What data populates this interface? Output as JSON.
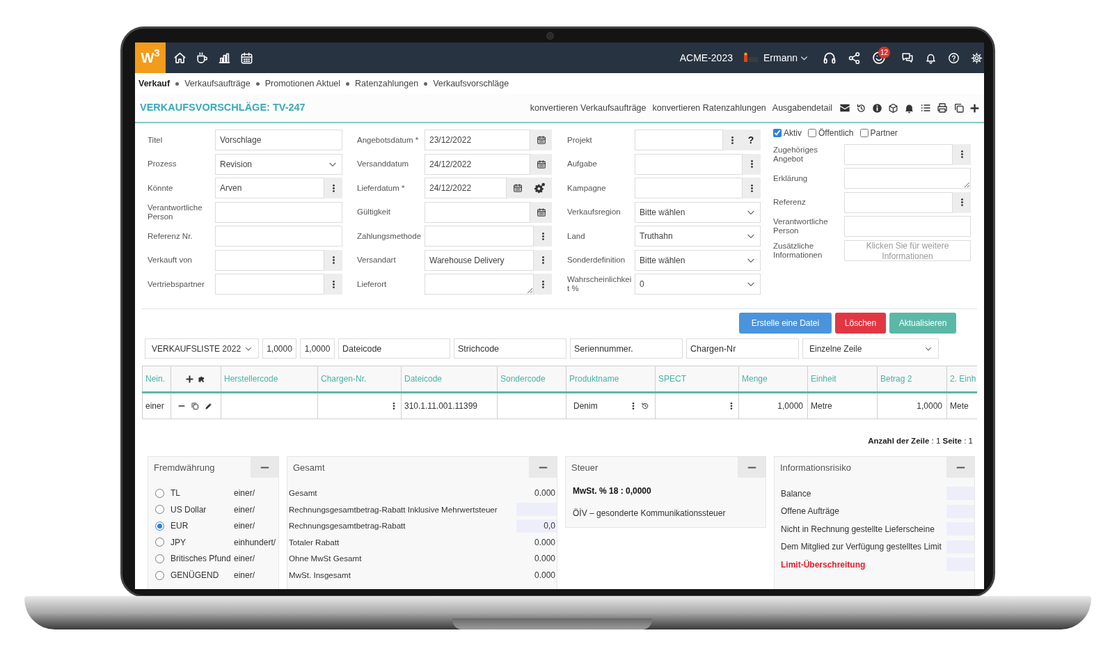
{
  "top_bar": {
    "logo": "W$^{3}$",
    "company": "ACME-2023",
    "user": "Ermann",
    "badge": "12"
  },
  "breadcrumb": [
    {
      "label": "Verkauf",
      "current": true
    },
    {
      "label": "Verkaufsaufträge",
      "current": false
    },
    {
      "label": "Promotionen Aktuel",
      "current": false
    },
    {
      "label": "Ratenzahlungen",
      "current": false
    },
    {
      "label": "Verkaufsvorschläge",
      "current": false
    }
  ],
  "page": {
    "title": "VERKAUFSVORSCHLÄGE: TV-247",
    "actions": [
      "konvertieren Verkaufsaufträge",
      "konvertieren Ratenzahlungen",
      "Ausgabendetail"
    ]
  },
  "form": {
    "columns": [
      {
        "fields": [
          {
            "label": "Titel",
            "kind": "text",
            "value": "Vorschlage"
          },
          {
            "label": "Prozess",
            "kind": "select",
            "value": "Revision"
          },
          {
            "label": "Könnte",
            "kind": "lookup",
            "value": "Arven"
          },
          {
            "label": "Verantwortliche Person",
            "kind": "text"
          },
          {
            "label": "Referenz Nr.",
            "kind": "text"
          },
          {
            "label": "Verkauft von",
            "kind": "lookup"
          },
          {
            "label": "Vertriebspartner",
            "kind": "lookup"
          }
        ]
      },
      {
        "fields": [
          {
            "label": "Angebotsdatum *",
            "kind": "date",
            "value": "23/12/2022"
          },
          {
            "label": "Versanddatum",
            "kind": "date",
            "value": "24/12/2022"
          },
          {
            "label": "Lieferdatum *",
            "kind": "date_config",
            "value": "24/12/2022"
          },
          {
            "label": "Gültigkeit",
            "kind": "date"
          },
          {
            "label": "Zahlungsmethode",
            "kind": "lookup"
          },
          {
            "label": "Versandart",
            "kind": "lookup",
            "value": "Warehouse Delivery"
          },
          {
            "label": "Lieferort",
            "kind": "textarea_lookup"
          }
        ]
      },
      {
        "fields": [
          {
            "label": "Projekt",
            "kind": "lookup_help",
            "help": "?"
          },
          {
            "label": "Aufgabe",
            "kind": "lookup"
          },
          {
            "label": "Kampagne",
            "kind": "lookup"
          },
          {
            "label": "Verkaufsregion",
            "kind": "select",
            "value": "Bitte wählen"
          },
          {
            "label": "Land",
            "kind": "select",
            "value": "Truthahn"
          },
          {
            "label": "Sonderdefinition",
            "kind": "select",
            "value": "Bitte wählen"
          },
          {
            "label": "Wahrscheinlichkeit %",
            "kind": "select",
            "value": "0"
          }
        ]
      },
      {
        "flags": [
          {
            "label": "Aktiv",
            "checked": true
          },
          {
            "label": "Öffentlich",
            "checked": false
          },
          {
            "label": "Partner",
            "checked": false
          }
        ],
        "fields": [
          {
            "label": "Zugehöriges Angebot",
            "kind": "lookup"
          },
          {
            "label": "Erklärung",
            "kind": "textarea"
          },
          {
            "label": "Referenz",
            "kind": "lookup"
          },
          {
            "label": "Verantwortliche Person",
            "kind": "text"
          },
          {
            "label": "Zusätzliche Informationen",
            "kind": "link_box",
            "placeholder": "Klicken Sie für weitere Informationen"
          }
        ]
      }
    ]
  },
  "buttons": [
    {
      "label": "Erstelle eine Datei",
      "kind": "primary"
    },
    {
      "label": "Löschen",
      "kind": "danger"
    },
    {
      "label": "Aktualisieren",
      "kind": "success"
    }
  ],
  "filters": [
    {
      "kind": "select",
      "value": "VERKAUFSLISTE 2022"
    },
    {
      "kind": "number",
      "value": "1,0000"
    },
    {
      "kind": "number",
      "value": "1,0000"
    },
    {
      "kind": "text",
      "placeholder": "Dateicode"
    },
    {
      "kind": "text",
      "placeholder": "Strichcode"
    },
    {
      "kind": "text",
      "placeholder": "Seriennummer."
    },
    {
      "kind": "text",
      "placeholder": "Chargen-Nr"
    },
    {
      "kind": "select",
      "value": "Einzelne Zeile"
    }
  ],
  "table": {
    "columns": [
      {
        "kind": "text",
        "label": "Nein."
      },
      {
        "kind": "actions"
      },
      {
        "kind": "text",
        "label": "Herstellercode"
      },
      {
        "kind": "text",
        "label": "Chargen-Nr."
      },
      {
        "kind": "text",
        "label": "Dateicode"
      },
      {
        "kind": "text",
        "label": "Sondercode"
      },
      {
        "kind": "text",
        "label": "Produktname"
      },
      {
        "kind": "text",
        "label": "SPECT"
      },
      {
        "kind": "text",
        "label": "Menge"
      },
      {
        "kind": "text",
        "label": "Einheit"
      },
      {
        "kind": "text",
        "label": "Betrag 2"
      },
      {
        "kind": "text",
        "label": "2. Einh"
      }
    ],
    "rows": [
      {
        "cells": [
          {
            "kind": "text",
            "text": "einer"
          },
          {
            "kind": "actions"
          },
          {
            "kind": "empty"
          },
          {
            "kind": "lookup"
          },
          {
            "kind": "text",
            "text": "310.1.11.001.11399"
          },
          {
            "kind": "empty"
          },
          {
            "kind": "product",
            "text": "Denim"
          },
          {
            "kind": "lookup"
          },
          {
            "kind": "number",
            "text": "1,0000"
          },
          {
            "kind": "text",
            "text": "Metre"
          },
          {
            "kind": "number",
            "text": "1,0000"
          },
          {
            "kind": "text",
            "text": "Mete"
          }
        ]
      }
    ]
  },
  "pager": "**Anzahl der Zeile** : 1 **Seite** : 1",
  "panels": {
    "currency": {
      "title": "Fremdwährung",
      "options": [
        {
          "label": "TL",
          "rate": "einer/",
          "selected": false
        },
        {
          "label": "US Dollar",
          "rate": "einer/",
          "selected": false
        },
        {
          "label": "EUR",
          "rate": "einer/",
          "selected": true
        },
        {
          "label": "JPY",
          "rate": "einhundert/",
          "selected": false
        },
        {
          "label": "Britisches Pfund",
          "rate": "einer/",
          "selected": false
        },
        {
          "label": "GENÜGEND",
          "rate": "einer/",
          "selected": false
        }
      ]
    },
    "totals": {
      "title": "Gesamt",
      "rows": [
        {
          "label": "Gesamt",
          "kind": "plain",
          "value": "0.000"
        },
        {
          "label": "Rechnungsgesamtbetrag-Rabatt Inklusive Mehrwertsteuer",
          "kind": "field"
        },
        {
          "label": "Rechnungsgesamtbetrag-Rabatt",
          "kind": "field",
          "value": "0,0"
        },
        {
          "label": "Totaler Rabatt",
          "kind": "plain",
          "value": "0.000"
        },
        {
          "label": "Ohne MwSt Gesamt",
          "kind": "plain",
          "value": "0.000"
        },
        {
          "label": "MwSt. Insgesamt",
          "kind": "plain",
          "value": "0.000"
        }
      ]
    },
    "tax": {
      "title": "Steuer",
      "lines": [
        {
          "text": "MwSt. % 18 : 0,0000",
          "kind": "total"
        },
        {
          "text": "ÖİV – gesonderte Kommunikationssteuer",
          "kind": "note"
        }
      ]
    },
    "risk": {
      "title": "Informationsrisiko",
      "rows": [
        {
          "label": "Balance",
          "kind": "normal"
        },
        {
          "label": "Offene Aufträge",
          "kind": "normal"
        },
        {
          "label": "Nicht in Rechnung gestellte Lieferscheine",
          "kind": "normal"
        },
        {
          "label": "Dem Mitglied zur Verfügung gestelltes Limit",
          "kind": "normal"
        },
        {
          "label": "Limit-Überschreitung",
          "kind": "alert"
        }
      ]
    }
  }
}
